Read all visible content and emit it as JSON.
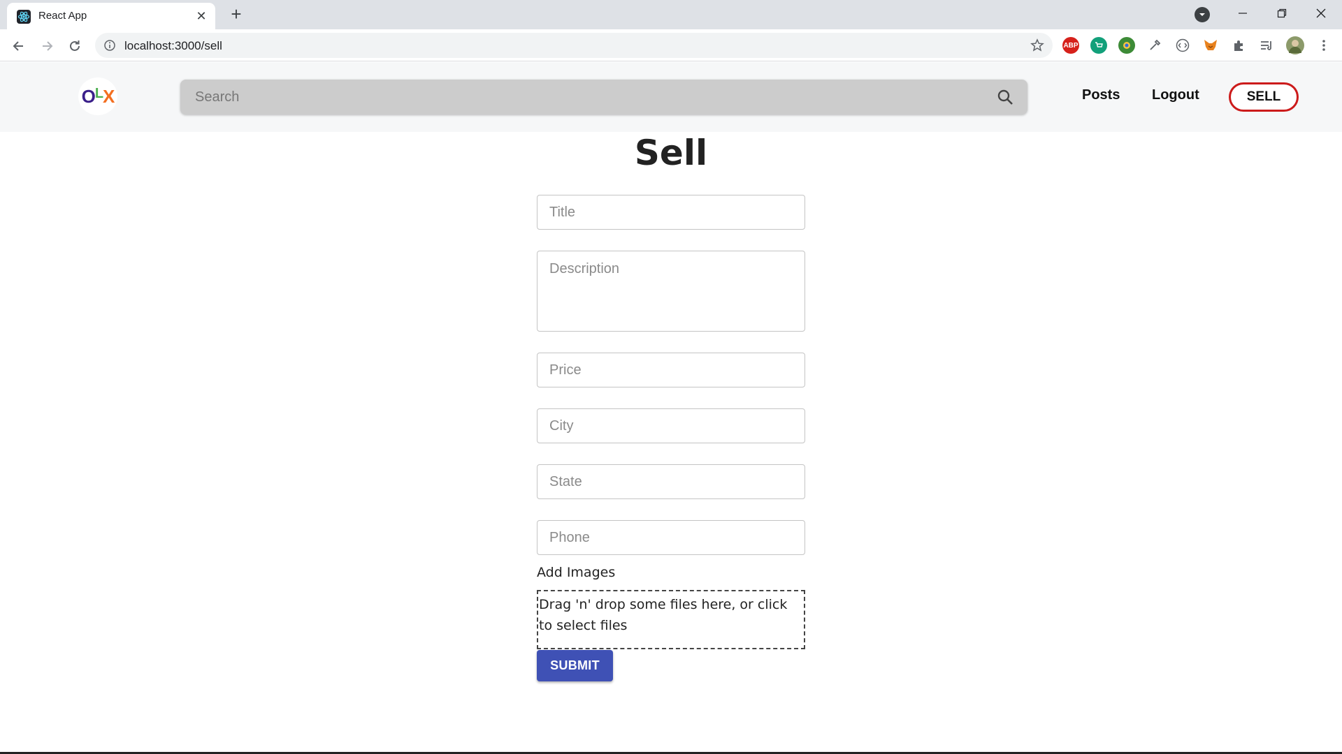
{
  "browser": {
    "tab_title": "React App",
    "tab_close": "✕",
    "new_tab": "+",
    "url": "localhost:3000/sell",
    "extensions": [
      {
        "name": "adblock-icon",
        "label": "ABP",
        "color": "#d6211b"
      },
      {
        "name": "shopping-extension-icon",
        "label": "",
        "color": "#12a07a"
      },
      {
        "name": "globe-extension-icon",
        "label": "",
        "color": "#3d8b37"
      },
      {
        "name": "eyedropper-extension-icon",
        "label": "",
        "color": "#8a8a8a"
      },
      {
        "name": "code-extension-icon",
        "label": "",
        "color": "#5f6368"
      },
      {
        "name": "metamask-icon",
        "label": "",
        "color": "#e8821e"
      }
    ]
  },
  "header": {
    "logo": {
      "o": "O",
      "l": "L",
      "x": "X"
    },
    "search_placeholder": "Search",
    "nav_posts": "Posts",
    "nav_logout": "Logout",
    "sell_label": "SELL",
    "colors": {
      "sell_border": "#cc1b1b",
      "logo_o": "#3a1f8a",
      "logo_l": "#4caf50",
      "logo_x": "#f36f21"
    }
  },
  "form": {
    "heading": "Sell",
    "title_placeholder": "Title",
    "description_placeholder": "Description",
    "price_placeholder": "Price",
    "city_placeholder": "City",
    "state_placeholder": "State",
    "phone_placeholder": "Phone",
    "add_images_label": "Add Images",
    "dropzone_text": "Drag 'n' drop some files here, or click to select files",
    "submit_label": "SUBMIT",
    "submit_color": "#3f51b5"
  }
}
